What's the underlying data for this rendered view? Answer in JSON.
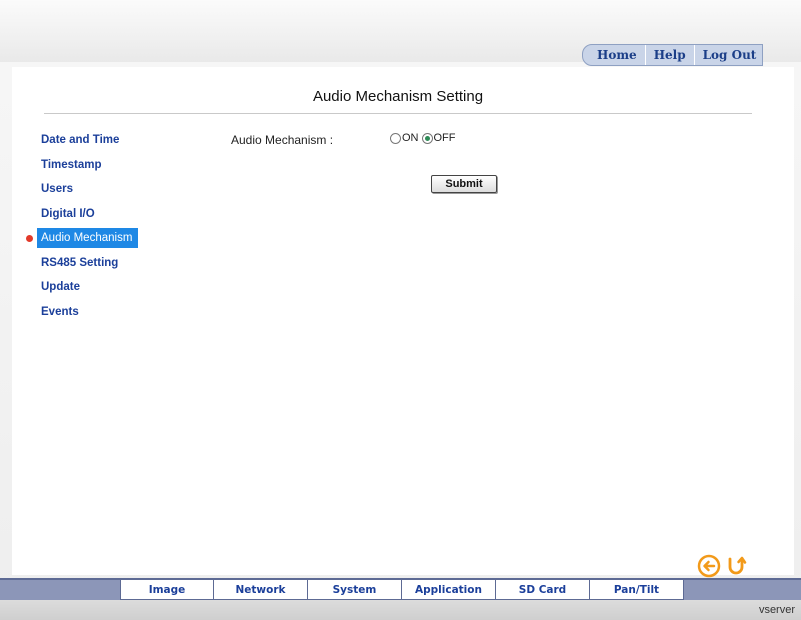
{
  "header": {
    "links": [
      {
        "label": "Home"
      },
      {
        "label": "Help"
      },
      {
        "label": "Log Out"
      }
    ]
  },
  "page": {
    "title": "Audio Mechanism Setting"
  },
  "sidebar": {
    "items": [
      {
        "label": "Date and Time"
      },
      {
        "label": "Timestamp"
      },
      {
        "label": "Users"
      },
      {
        "label": "Digital I/O"
      },
      {
        "label": "Audio Mechanism",
        "active": true
      },
      {
        "label": "RS485 Setting"
      },
      {
        "label": "Update"
      },
      {
        "label": "Events"
      }
    ]
  },
  "form": {
    "field_label": "Audio Mechanism :",
    "options": [
      {
        "label": "ON",
        "checked": false
      },
      {
        "label": "OFF",
        "checked": true
      }
    ],
    "submit_label": "Submit"
  },
  "nav_icons": [
    {
      "icon": "back-arrow-icon"
    },
    {
      "icon": "refresh-icon"
    }
  ],
  "bottom_nav": {
    "tabs": [
      {
        "label": "Image"
      },
      {
        "label": "Network"
      },
      {
        "label": "System"
      },
      {
        "label": "Application"
      },
      {
        "label": "SD Card"
      },
      {
        "label": "Pan/Tilt"
      }
    ]
  },
  "footer": {
    "brand": "vserver"
  },
  "colors": {
    "link_blue": "#1b3f9a",
    "active_highlight": "#1e88e5",
    "active_dot": "#e23a2a",
    "icon_orange": "#f29a1a"
  }
}
